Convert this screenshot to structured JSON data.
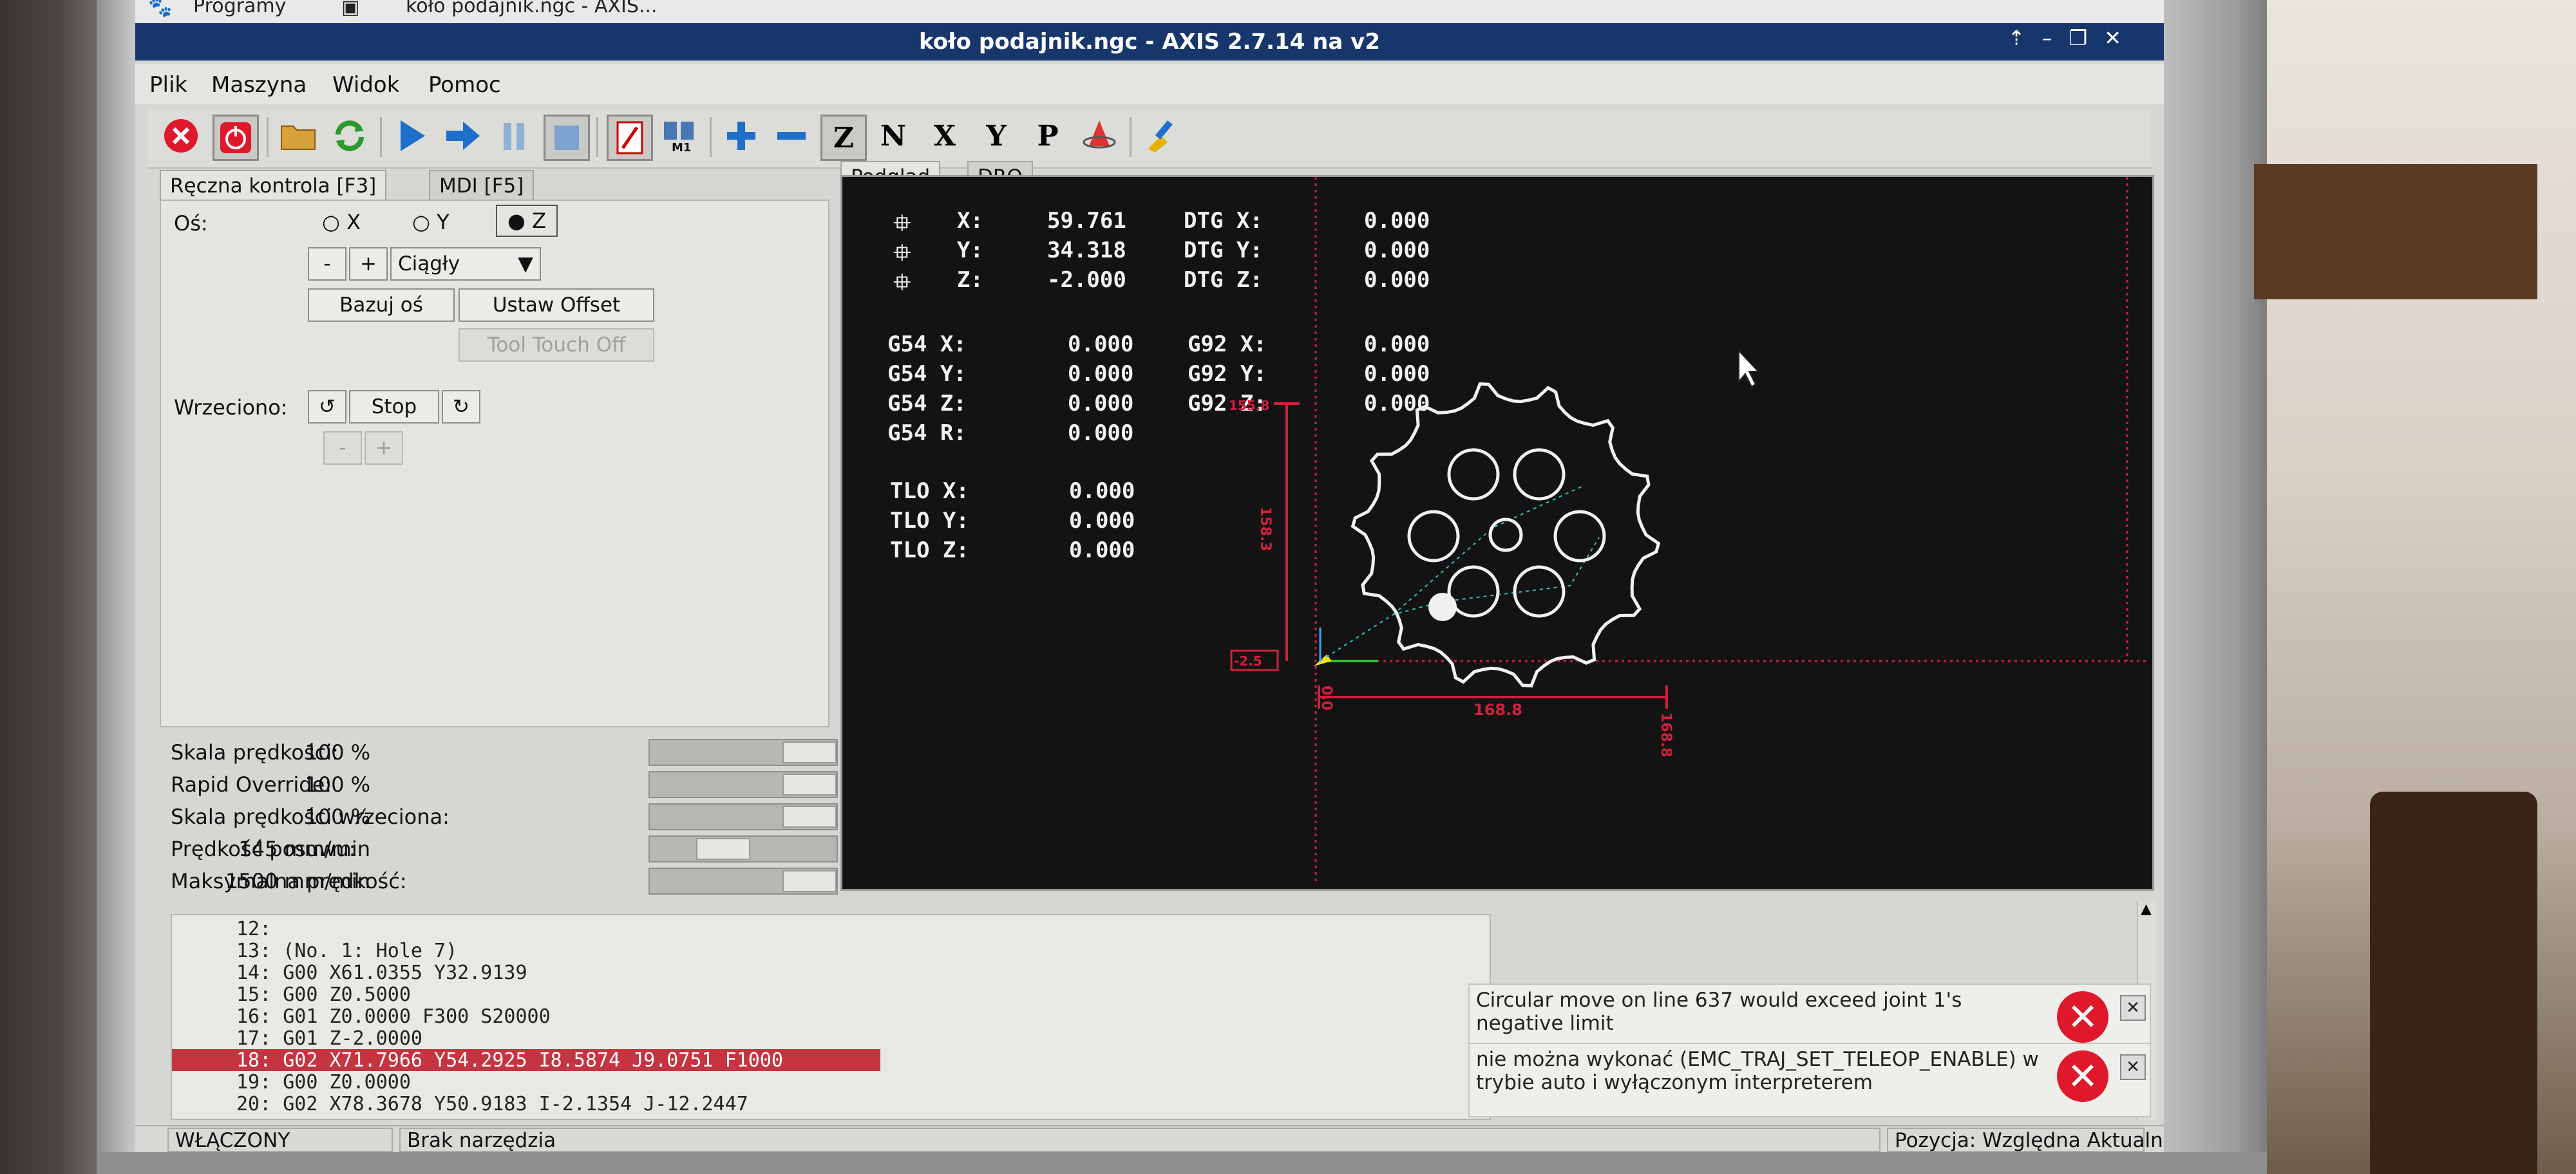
{
  "taskbar": {
    "apps_label": "Programy",
    "task_label": "koło podajnik.ngc - AXIS..."
  },
  "window": {
    "title": "koło podajnik.ngc - AXIS 2.7.14 na v2"
  },
  "menu": [
    "Plik",
    "Maszyna",
    "Widok",
    "Pomoc"
  ],
  "toolbar": [
    "estop-icon",
    "power-icon",
    "open-icon",
    "reload-icon",
    "run-icon",
    "step-icon",
    "pause-icon",
    "stop-icon",
    "block-delete-icon",
    "optional-stop-icon",
    "zoom-in-icon",
    "zoom-out-icon",
    "view-z-icon",
    "view-z2-icon",
    "view-x-icon",
    "view-y-icon",
    "view-p-icon",
    "rotate-icon",
    "clear-icon"
  ],
  "left_tabs": [
    "Ręczna kontrola [F3]",
    "MDI [F5]"
  ],
  "manual": {
    "axis_label": "Oś:",
    "axes": [
      "X",
      "Y",
      "Z"
    ],
    "selected_axis": "Z",
    "minus": "-",
    "plus": "+",
    "jog_mode": "Ciągły",
    "home_button": "Bazuj oś",
    "offset_button": "Ustaw Offset",
    "touch_off_button": "Tool Touch Off",
    "spindle_label": "Wrzeciono:",
    "spindle_stop": "Stop"
  },
  "overrides": [
    {
      "label": "Skala prędkości:",
      "value": "100 %",
      "fraction": 1.0
    },
    {
      "label": "Rapid Override:",
      "value": "100 %",
      "fraction": 1.0
    },
    {
      "label": "Skala prędkości wrzeciona:",
      "value": "100 %",
      "fraction": 1.0
    },
    {
      "label": "Prędkość posuwu:",
      "value": "145 mm/min",
      "fraction": 0.35
    },
    {
      "label": "Maksymalna prędkość:",
      "value": "1500 mm/min",
      "fraction": 1.0
    }
  ],
  "right_tabs": [
    "Podgląd",
    "DRO"
  ],
  "dro": {
    "pos": [
      {
        "axis": "X:",
        "value": "59.761",
        "dtg_label": "DTG X:",
        "dtg": "0.000"
      },
      {
        "axis": "Y:",
        "value": "34.318",
        "dtg_label": "DTG Y:",
        "dtg": "0.000"
      },
      {
        "axis": "Z:",
        "value": "-2.000",
        "dtg_label": "DTG Z:",
        "dtg": "0.000"
      }
    ],
    "g54": [
      {
        "label": "G54 X:",
        "value": "0.000",
        "g92_label": "G92 X:",
        "g92": "0.000"
      },
      {
        "label": "G54 Y:",
        "value": "0.000",
        "g92_label": "G92 Y:",
        "g92": "0.000"
      },
      {
        "label": "G54 Z:",
        "value": "0.000",
        "g92_label": "G92 Z:",
        "g92": "0.000"
      },
      {
        "label": "G54 R:",
        "value": "0.000"
      }
    ],
    "tlo": [
      {
        "label": "TLO X:",
        "value": "0.000"
      },
      {
        "label": "TLO Y:",
        "value": "0.000"
      },
      {
        "label": "TLO Z:",
        "value": "0.000"
      }
    ]
  },
  "preview": {
    "dim_height": "158.3",
    "dim_height_top": "155.8",
    "dim_width": "168.8",
    "dim_width_end": "168.8",
    "dim_origin": "0.0",
    "dim_z": "-2.5"
  },
  "gcode": [
    {
      "n": "12:",
      "code": ""
    },
    {
      "n": "13:",
      "code": "(No. 1: Hole 7)"
    },
    {
      "n": "14:",
      "code": "G00 X61.0355 Y32.9139"
    },
    {
      "n": "15:",
      "code": "G00 Z0.5000"
    },
    {
      "n": "16:",
      "code": "G01 Z0.0000 F300 S20000"
    },
    {
      "n": "17:",
      "code": "G01 Z-2.0000"
    },
    {
      "n": "18:",
      "code": "G02 X71.7966 Y54.2925 I8.5874 J9.0751 F1000"
    },
    {
      "n": "19:",
      "code": "G00 Z0.0000"
    },
    {
      "n": "20:",
      "code": "G02 X78.3678 Y50.9183 I-2.1354 J-12.2447"
    }
  ],
  "messages": [
    "Circular move on line 637 would exceed joint 1's negative limit",
    "nie można wykonać (EMC_TRAJ_SET_TELEOP_ENABLE) w trybie auto i wyłączonym interpreterem"
  ],
  "status": {
    "state": "WŁĄCZONY",
    "tool": "Brak narzędzia",
    "position": "Pozycja: Względna Aktualna"
  }
}
